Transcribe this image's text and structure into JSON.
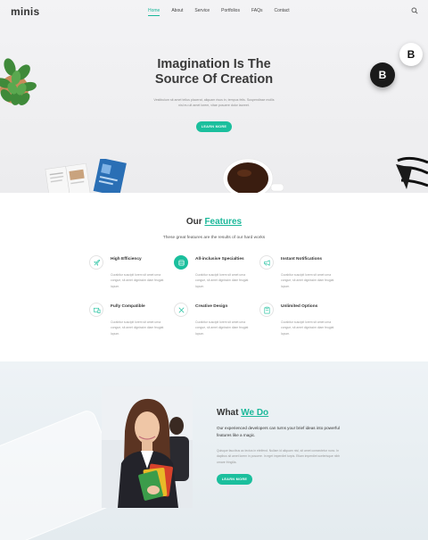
{
  "header": {
    "logo": "minis",
    "nav": [
      "Home",
      "About",
      "Service",
      "Portfolios",
      "FAQs",
      "Contact"
    ],
    "active_nav": "Home",
    "search_icon": "search-icon"
  },
  "hero": {
    "title_line1": "Imagination Is The",
    "title_line2": "Source Of Creation",
    "subtitle_line1": "Vestibulum sit amet tellus placerat, aliquam risus in, tempus felis. Suspendisse mollis",
    "subtitle_line2": "nisl eu ult amet lorem, vitae posuere dolor laoreet.",
    "button": "LEARN MORE",
    "coin_black": "B",
    "coin_white": "B"
  },
  "features": {
    "title_plain": "Our",
    "title_accent": "Features",
    "subtitle": "These great features are the results of our hard works",
    "items": [
      {
        "title": "High Efficiency",
        "text": "Curabitur suscipit lorem sit amet urna congue, sit amet dignissim diam feugiat lopum.",
        "icon": "rocket-icon"
      },
      {
        "title": "All-inclusive Specialties",
        "text": "Curabitur suscipit lorem sit amet urna congue, sit amet dignissim diam feugiat lopum.",
        "icon": "stack-icon"
      },
      {
        "title": "Instant Notifications",
        "text": "Curabitur suscipit lorem sit amet urna congue, sit amet dignissim diam feugiat lopum.",
        "icon": "megaphone-icon"
      },
      {
        "title": "Fully Compatible",
        "text": "Curabitur suscipit lorem sit amet urna congue, sit amet dignissim diam feugiat lopum.",
        "icon": "devices-icon"
      },
      {
        "title": "Creative Design",
        "text": "Curabitur suscipit lorem sit amet urna congue, sit amet dignissim diam feugiat lopum.",
        "icon": "design-tools-icon"
      },
      {
        "title": "Unlimited Options",
        "text": "Curabitur suscipit lorem sit amet urna congue, sit amet dignissim diam feugiat lopum.",
        "icon": "clipboard-icon"
      }
    ]
  },
  "about": {
    "title_plain": "What",
    "title_accent": "We Do",
    "lead": "Our experienced developers can turns your brief ideas into powerful features like a magic.",
    "body": "Quisque faucibus ac lectus in eleifend. Nullam id aliquam nisl, sit amet consectetur nunc. In dapibus sit amet lorem in posuere. In eget imperdiet turpis. Etiam imperdiet scelerisque nibh ornare fringilla.",
    "button": "LEARN MORE"
  },
  "colors": {
    "accent": "#1bbf9d",
    "hero_bg": "#efeff1",
    "about_bg": "#e9eff3"
  }
}
